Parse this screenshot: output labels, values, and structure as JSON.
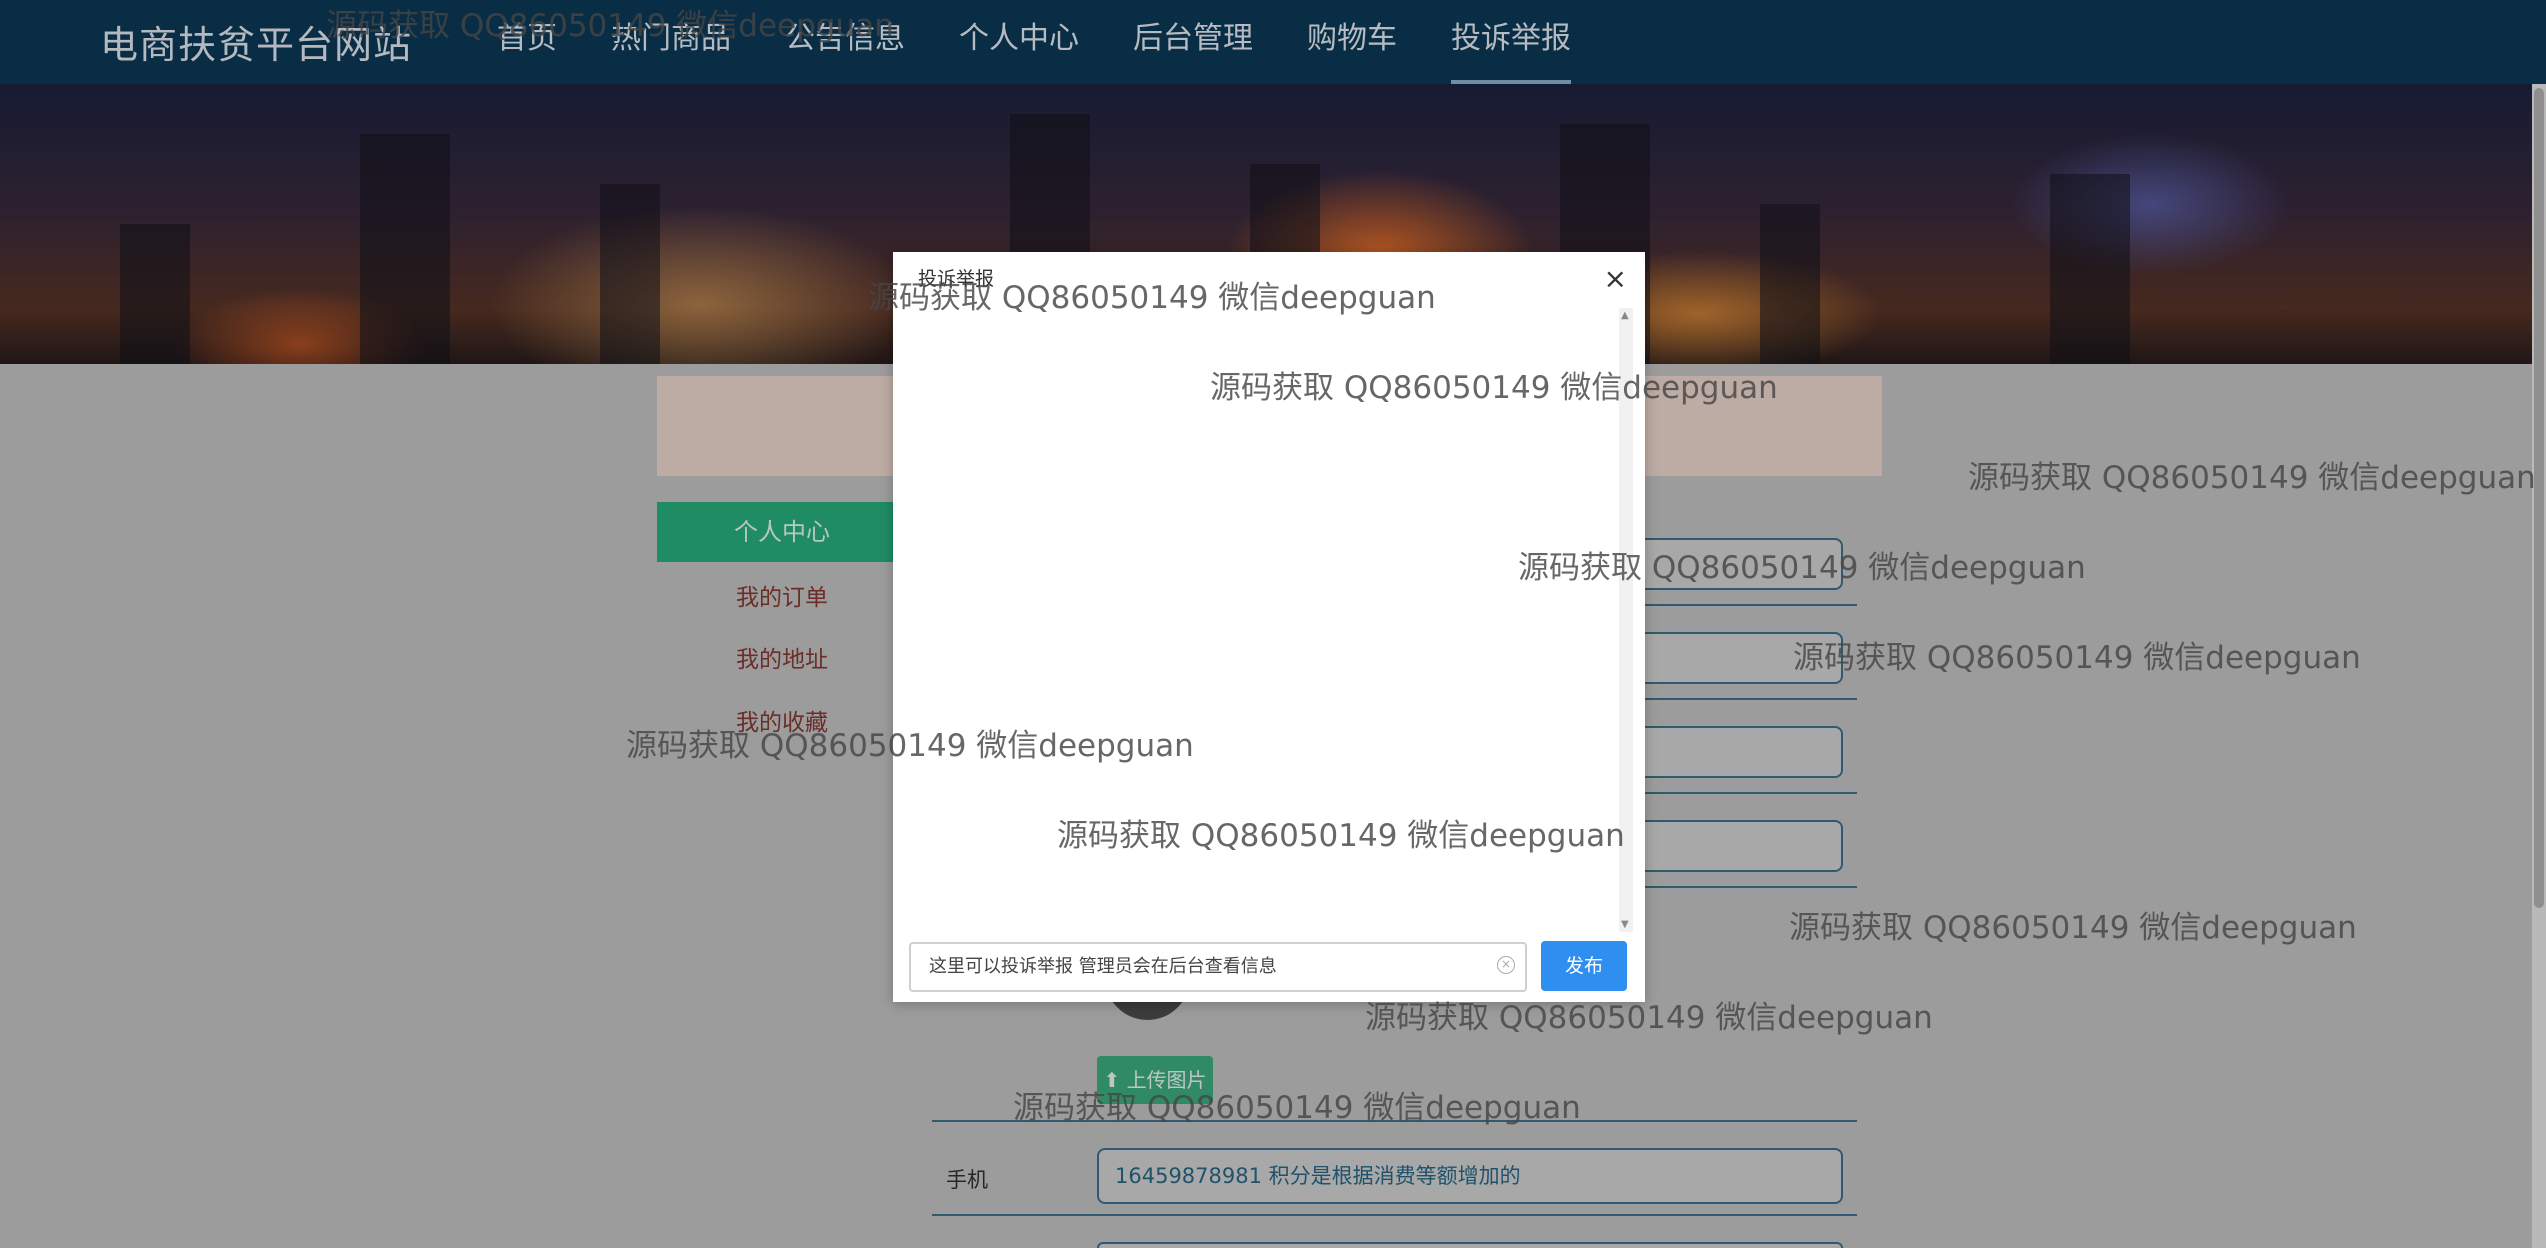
{
  "site": {
    "brand": "电商扶贫平台网站"
  },
  "nav": {
    "items": [
      "首页",
      "热门商品",
      "公告信息",
      "个人中心",
      "后台管理",
      "购物车",
      "投诉举报"
    ],
    "active_index": 6
  },
  "sidebar": {
    "active_label": "个人中心",
    "links": [
      "我的订单",
      "我的地址",
      "我的收藏"
    ]
  },
  "profile": {
    "upload_label": "上传图片",
    "phone_label": "手机",
    "phone_value": "16459878981 积分是根据消费等额增加的"
  },
  "dialog": {
    "title": "投诉举报",
    "close_glyph": "×",
    "input_value": "这里可以投诉举报 管理员会在后台查看信息",
    "publish_label": "发布"
  },
  "watermark": {
    "text": "源码获取 QQ86050149 微信deepguan"
  },
  "colors": {
    "nav_bg": "#0d3a5a",
    "sidebar_active": "#29b47f",
    "publish_button": "#2e8ff0"
  }
}
